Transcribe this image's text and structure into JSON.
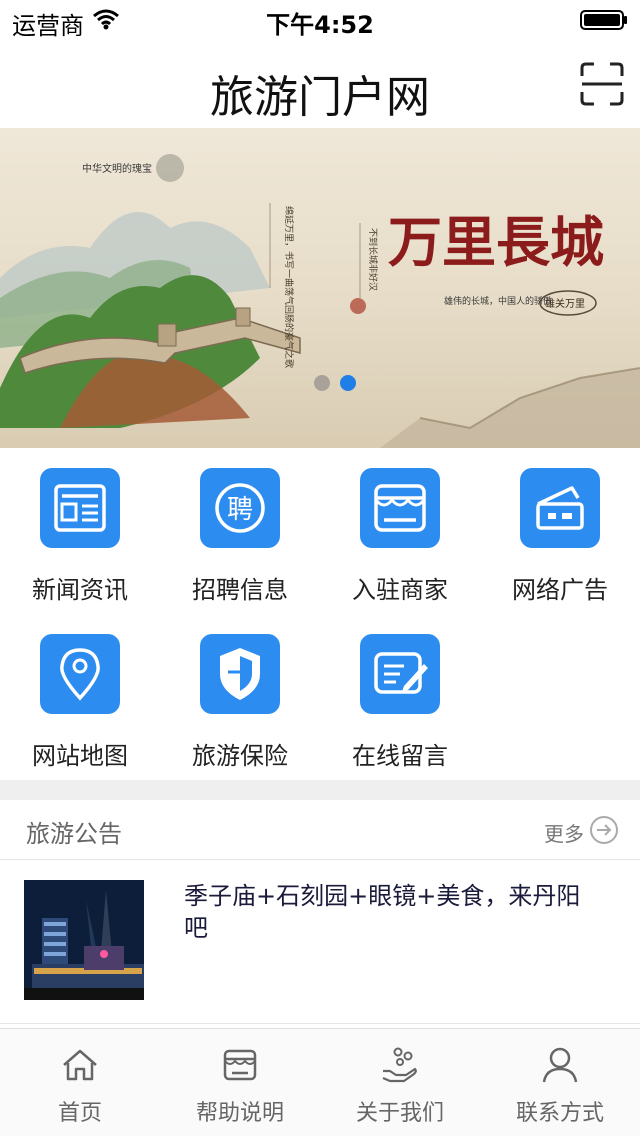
{
  "status_bar": {
    "carrier": "运营商",
    "time": "下午4:52"
  },
  "nav": {
    "title": "旅游门户网"
  },
  "banner": {
    "active_slide": 2,
    "slide_count": 2,
    "text_title": "万里長城",
    "text_subtitle": "中华文明的瑰宝",
    "text_caption": "雄伟的长城，中国人的骄傲",
    "text_seal": "雄关万里",
    "text_verse_1": "不到长城非好汉",
    "text_verse_2": "绵延万里，书写一曲荡气回肠的豪气之歌"
  },
  "grid": {
    "items": [
      {
        "label": "新闻资讯",
        "icon": "newspaper-icon"
      },
      {
        "label": "招聘信息",
        "icon": "recruit-icon",
        "glyph": "聘"
      },
      {
        "label": "入驻商家",
        "icon": "store-icon"
      },
      {
        "label": "网络广告",
        "icon": "ad-icon"
      },
      {
        "label": "网站地图",
        "icon": "map-pin-icon"
      },
      {
        "label": "旅游保险",
        "icon": "shield-icon"
      },
      {
        "label": "在线留言",
        "icon": "message-edit-icon"
      }
    ]
  },
  "notice": {
    "title": "旅游公告",
    "more_label": "更多",
    "items": [
      {
        "title": "季子庙+石刻园+眼镜+美食，来丹阳吧"
      }
    ]
  },
  "tab_bar": {
    "tabs": [
      {
        "label": "首页",
        "icon": "home-icon"
      },
      {
        "label": "帮助说明",
        "icon": "help-store-icon"
      },
      {
        "label": "关于我们",
        "icon": "about-hand-icon"
      },
      {
        "label": "联系方式",
        "icon": "person-icon"
      }
    ]
  },
  "colors": {
    "accent": "#2d8cf0",
    "active_dot": "#1f7fe6",
    "divider": "#efefef"
  }
}
